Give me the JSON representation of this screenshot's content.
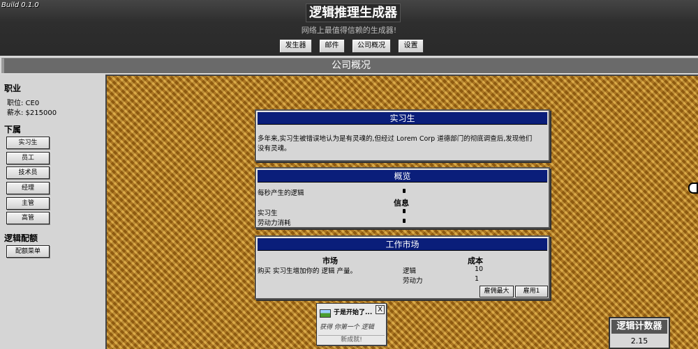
{
  "header": {
    "build": "Build 0.1.0",
    "title": "逻辑推理生成器",
    "subtitle": "网络上最值得信赖的生成器!"
  },
  "nav": {
    "generator": "发生器",
    "mail": "邮件",
    "company": "公司概况",
    "settings": "设置"
  },
  "section_title": "公司概况",
  "sidebar": {
    "career_heading": "职业",
    "position": "职位: CE0",
    "salary": "薪水: $215000",
    "subordinates_heading": "下属",
    "roles": [
      "实习生",
      "员工",
      "技术员",
      "经理",
      "主管",
      "高管"
    ],
    "logic_heading": "逻辑配额",
    "quota_menu": "配额菜单"
  },
  "intern_panel": {
    "title": "实习生",
    "desc_line1": "多年来,实习生被错误地认为是有灵魂的,但经过 Lorem Corp 道德部门的彻底调查后,发现他们",
    "desc_line2": "没有灵魂。"
  },
  "overview_panel": {
    "title": "概览",
    "logic_per_sec": "每秒产生的逻辑",
    "info_heading": "信息",
    "interns": "实习生",
    "labor_cost": "劳动力消耗"
  },
  "market_panel": {
    "title": "工作市场",
    "market_heading": "市场",
    "cost_heading": "成本",
    "buy_desc": "购买 实习生增加你的 逻辑 产量。",
    "logic_label": "逻辑",
    "logic_cost": "10",
    "labor_label": "劳动力",
    "labor_cost": "1",
    "hire_max": "雇佣最大",
    "hire_one": "雇用1"
  },
  "notification": {
    "title": "于是开始了...",
    "body": "获得 你第一个 逻辑",
    "footer": "新成就!",
    "close": "X"
  },
  "counter": {
    "label": "逻辑计数器",
    "value": "2.15"
  }
}
